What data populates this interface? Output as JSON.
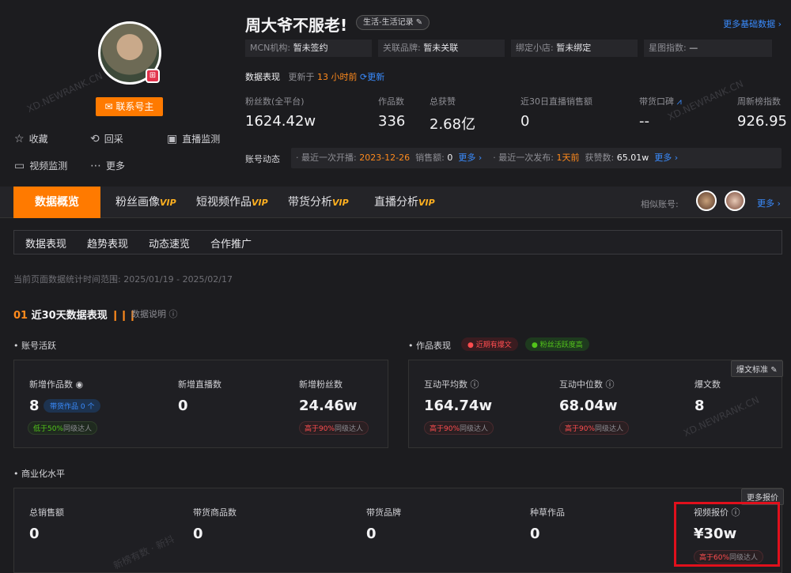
{
  "profile": {
    "name": "周大爷不服老!",
    "category": "生活-生活记录",
    "contact_label": "联系号主",
    "more_basic": "更多基础数据"
  },
  "info": [
    {
      "k": "MCN机构:",
      "v": "暂未签约"
    },
    {
      "k": "关联品牌:",
      "v": "暂未关联"
    },
    {
      "k": "绑定小店:",
      "v": "暂未绑定"
    },
    {
      "k": "星图指数:",
      "v": "—"
    }
  ],
  "perf": {
    "title": "数据表现",
    "updated_prefix": "更新于",
    "updated_value": "13 小时前",
    "refresh": "更新"
  },
  "stats": [
    {
      "label": "粉丝数(全平台)",
      "value": "1624.42w"
    },
    {
      "label": "作品数",
      "value": "336"
    },
    {
      "label": "总获赞",
      "value": "2.68亿"
    },
    {
      "label": "近30日直播销售额",
      "value": "0"
    },
    {
      "label": "带货口碑",
      "value": "--"
    },
    {
      "label": "周新榜指数",
      "value": "926.95"
    }
  ],
  "dynamics": {
    "title": "账号动态",
    "live_label": "最近一次开播:",
    "live_date": "2023-12-26",
    "sales_label": "销售额:",
    "sales_value": "0",
    "more1": "更多 ›",
    "pub_label": "最近一次发布:",
    "pub_value": "1天前",
    "likes_label": "获赞数:",
    "likes_value": "65.01w",
    "more2": "更多 ›"
  },
  "quick": {
    "fav": "收藏",
    "back": "回采",
    "live_mon": "直播监测",
    "video_mon": "视频监测",
    "more": "更多"
  },
  "tabs": {
    "overview": "数据概览",
    "fans": "粉丝画像",
    "video": "短视频作品",
    "goods": "带货分析",
    "live": "直播分析",
    "vip": "VIP",
    "similar": "相似账号:",
    "more": "更多 ›"
  },
  "subtabs": [
    "数据表现",
    "趋势表现",
    "动态速览",
    "合作推广"
  ],
  "range": "当前页面数据统计时间范围: 2025/01/19 - 2025/02/17",
  "section": {
    "num": "01",
    "title": "近30天数据表现",
    "note": "数据说明"
  },
  "activity": {
    "title": "账号活跃",
    "items": [
      {
        "label": "新增作品数",
        "value": "8",
        "chip": "带货作品 0 个",
        "compare": "低于",
        "pct": "50%",
        "tail": "同级达人"
      },
      {
        "label": "新增直播数",
        "value": "0"
      },
      {
        "label": "新增粉丝数",
        "value": "24.46w",
        "compare": "高于",
        "pct": "90%",
        "tail": "同级达人"
      }
    ]
  },
  "works": {
    "title": "作品表现",
    "badge1": "近期有爆文",
    "badge2": "粉丝活跃度高",
    "btn": "爆文标准",
    "items": [
      {
        "label": "互动平均数",
        "value": "164.74w",
        "compare": "高于",
        "pct": "90%",
        "tail": "同级达人"
      },
      {
        "label": "互动中位数",
        "value": "68.04w",
        "compare": "高于",
        "pct": "90%",
        "tail": "同级达人"
      },
      {
        "label": "爆文数",
        "value": "8"
      }
    ]
  },
  "commerce": {
    "title": "商业化水平",
    "btn": "更多报价",
    "items": [
      {
        "label": "总销售额",
        "value": "0"
      },
      {
        "label": "带货商品数",
        "value": "0"
      },
      {
        "label": "带货品牌",
        "value": "0"
      },
      {
        "label": "种草作品",
        "value": "0"
      },
      {
        "label": "视频报价",
        "value": "¥30w",
        "compare": "高于",
        "pct": "60%",
        "tail": "同级达人"
      }
    ]
  },
  "watermarks": [
    "XD.NEWRANK.CN",
    "新榜有数 · 新抖"
  ]
}
